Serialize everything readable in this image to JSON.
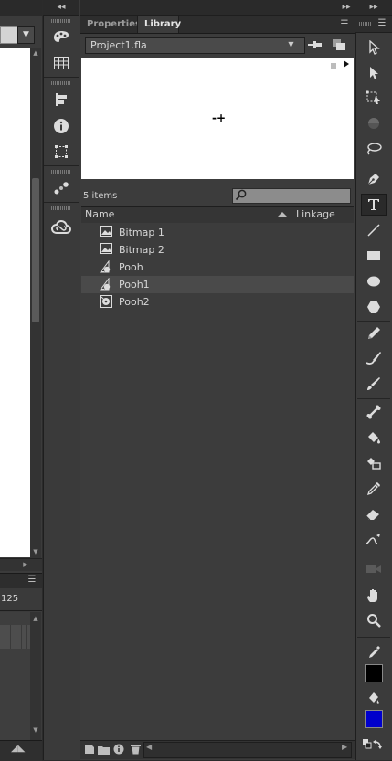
{
  "tabs": {
    "properties": "Properties",
    "library": "Library"
  },
  "library": {
    "document": "Project1.fla",
    "item_count": "5 items",
    "search_placeholder": "",
    "columns": {
      "name": "Name",
      "linkage": "Linkage"
    },
    "items": [
      {
        "label": "Bitmap 1",
        "icon": "bitmap-icon",
        "selected": false
      },
      {
        "label": "Bitmap 2",
        "icon": "bitmap-icon",
        "selected": false
      },
      {
        "label": "Pooh",
        "icon": "graphic-symbol-icon",
        "selected": false
      },
      {
        "label": "Pooh1",
        "icon": "graphic-symbol-icon",
        "selected": true
      },
      {
        "label": "Pooh2",
        "icon": "movie-clip-icon",
        "selected": false
      }
    ]
  },
  "timeline": {
    "frame_label": "125"
  },
  "colors": {
    "stroke": "#000000",
    "fill": "#0000cc",
    "panel_bg": "#3c3c3c",
    "selected_row": "#4a4a4a"
  },
  "dock_icons": [
    "color-palette-icon",
    "swatches-icon",
    "align-icon",
    "info-icon",
    "transform-icon",
    "motion-presets-icon",
    "creative-cloud-icon"
  ],
  "tool_icons": [
    "selection-tool-icon",
    "subselection-tool-icon",
    "free-transform-tool-icon",
    "3d-rotation-tool-icon",
    "lasso-tool-icon",
    "pen-tool-icon",
    "text-tool-icon",
    "line-tool-icon",
    "rectangle-tool-icon",
    "oval-tool-icon",
    "polystar-tool-icon",
    "pencil-tool-icon",
    "brush-tool-icon",
    "paint-brush-tool-icon",
    "bone-tool-icon",
    "paint-bucket-tool-icon",
    "ink-bottle-tool-icon",
    "eyedropper-tool-icon",
    "eraser-tool-icon",
    "width-tool-icon",
    "camera-tool-icon",
    "hand-tool-icon",
    "zoom-tool-icon",
    "stroke-color-icon",
    "fill-color-icon",
    "swap-colors-icon"
  ]
}
